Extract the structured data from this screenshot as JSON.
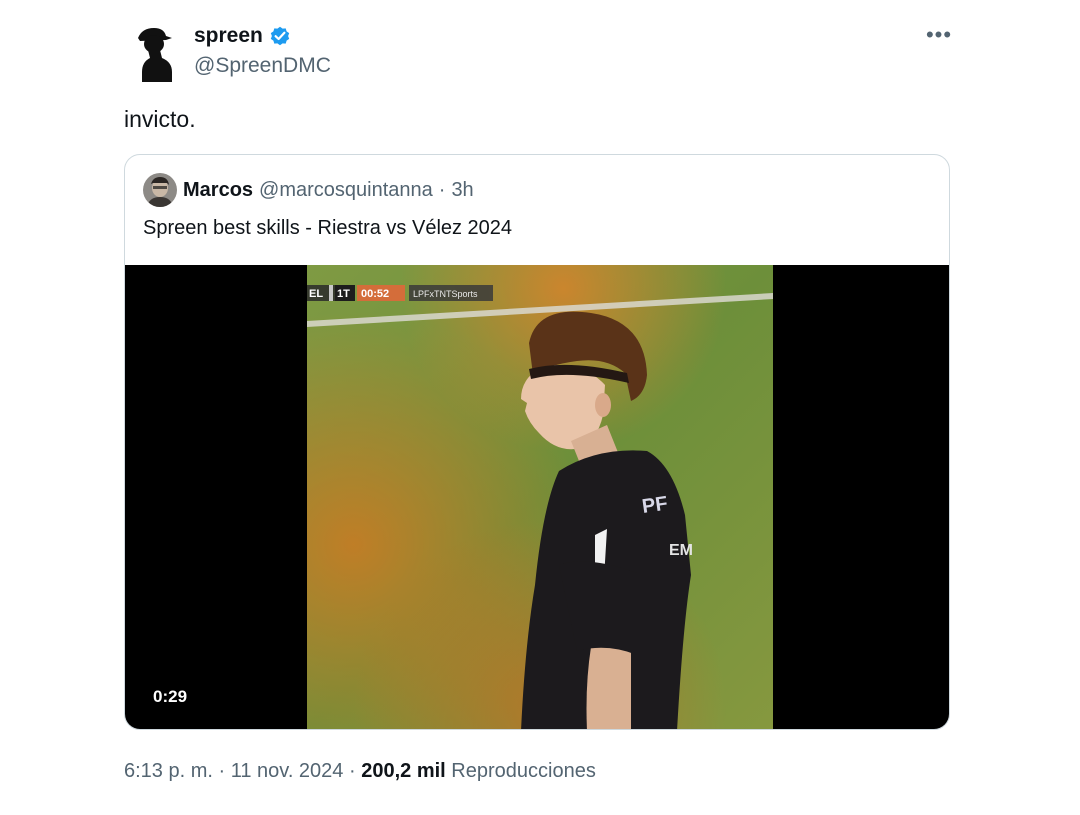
{
  "author": {
    "display_name": "spreen",
    "handle": "@SpreenDMC",
    "verified": true,
    "avatar_icon": "silhouette-avatar-icon"
  },
  "tweet": {
    "text": "invicto.",
    "more_icon": "•••"
  },
  "quoted": {
    "display_name": "Marcos",
    "handle": "@marcosquintanna",
    "separator": "·",
    "time": "3h",
    "text": "Spreen best skills - Riestra vs Vélez 2024",
    "video_duration": "0:29",
    "scoreboard": {
      "team": "EL",
      "period": "1T",
      "clock": "00:52",
      "broadcaster": "LPFxTNTSports"
    }
  },
  "meta": {
    "time": "6:13 p. m.",
    "sep1": "·",
    "date": "11 nov. 2024",
    "sep2": "·",
    "views_count": "200,2 mil",
    "views_label": "Reproducciones"
  },
  "colors": {
    "verified_blue": "#1d9bf0",
    "secondary_text": "#536471",
    "border": "#cfd9de"
  }
}
